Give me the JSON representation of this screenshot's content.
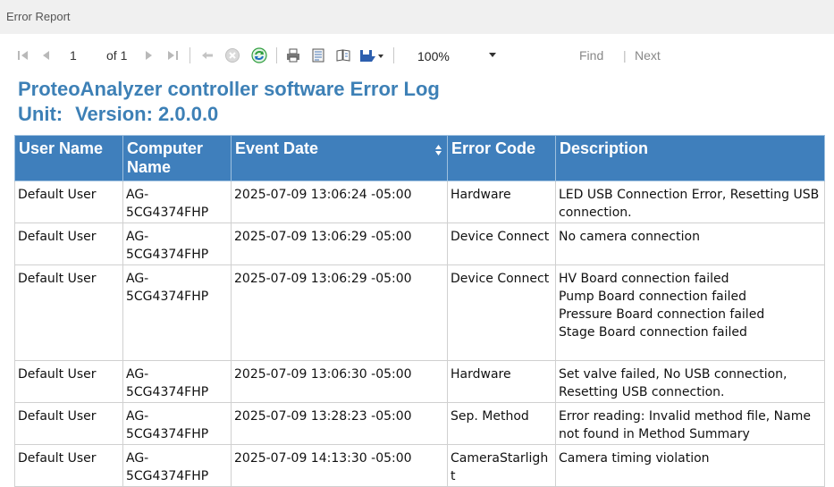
{
  "window": {
    "title": "Error Report"
  },
  "toolbar": {
    "page_current": "1",
    "page_of": "of 1",
    "zoom": "100%",
    "find_label": "Find",
    "find_sep": "|",
    "next_label": "Next"
  },
  "report": {
    "title": "ProteoAnalyzer controller software Error Log",
    "unit_label": "Unit:",
    "version_label": "Version: 2.0.0.0"
  },
  "table": {
    "headers": [
      "User Name",
      "Computer Name",
      "Event Date",
      "Error Code",
      "Description"
    ],
    "rows": [
      {
        "user": "Default User",
        "computer": "AG-5CG4374FHP",
        "date": "2025-07-09 13:06:24 -05:00",
        "code": "Hardware",
        "desc": [
          "LED USB Connection Error, Resetting USB connection."
        ]
      },
      {
        "user": "Default User",
        "computer": "AG-5CG4374FHP",
        "date": "2025-07-09 13:06:29 -05:00",
        "code": "Device Connect",
        "desc": [
          "No camera connection"
        ]
      },
      {
        "user": "Default User",
        "computer": "AG-5CG4374FHP",
        "date": "2025-07-09 13:06:29 -05:00",
        "code": "Device Connect",
        "desc": [
          "HV Board connection failed",
          "Pump Board connection failed",
          "Pressure Board connection failed",
          "Stage Board connection failed"
        ]
      },
      {
        "user": "Default User",
        "computer": "AG-5CG4374FHP",
        "date": "2025-07-09 13:06:30 -05:00",
        "code": "Hardware",
        "desc": [
          "Set valve failed, No USB connection, Resetting USB connection."
        ]
      },
      {
        "user": "Default User",
        "computer": "AG-5CG4374FHP",
        "date": "2025-07-09 13:28:23 -05:00",
        "code": "Sep. Method",
        "desc": [
          "Error reading: Invalid method file, Name not found in Method Summary"
        ]
      },
      {
        "user": "Default User",
        "computer": "AG-5CG4374FHP",
        "date": "2025-07-09 14:13:30 -05:00",
        "code": "CameraStarlight",
        "desc": [
          "Camera timing violation"
        ]
      }
    ]
  },
  "icons": {
    "first": "first-page-icon",
    "prev": "previous-page-icon",
    "next": "next-page-icon",
    "last": "last-page-icon",
    "back": "back-icon",
    "stop": "stop-icon",
    "refresh": "refresh-icon",
    "print": "print-icon",
    "layout": "print-layout-icon",
    "setup": "page-setup-icon",
    "export": "export-icon",
    "sort": "sort-icon"
  },
  "colors": {
    "header_bg": "#3f7fbc",
    "title": "#3d80b6",
    "refresh": "#2f9e3e",
    "export": "#2d5fae"
  }
}
